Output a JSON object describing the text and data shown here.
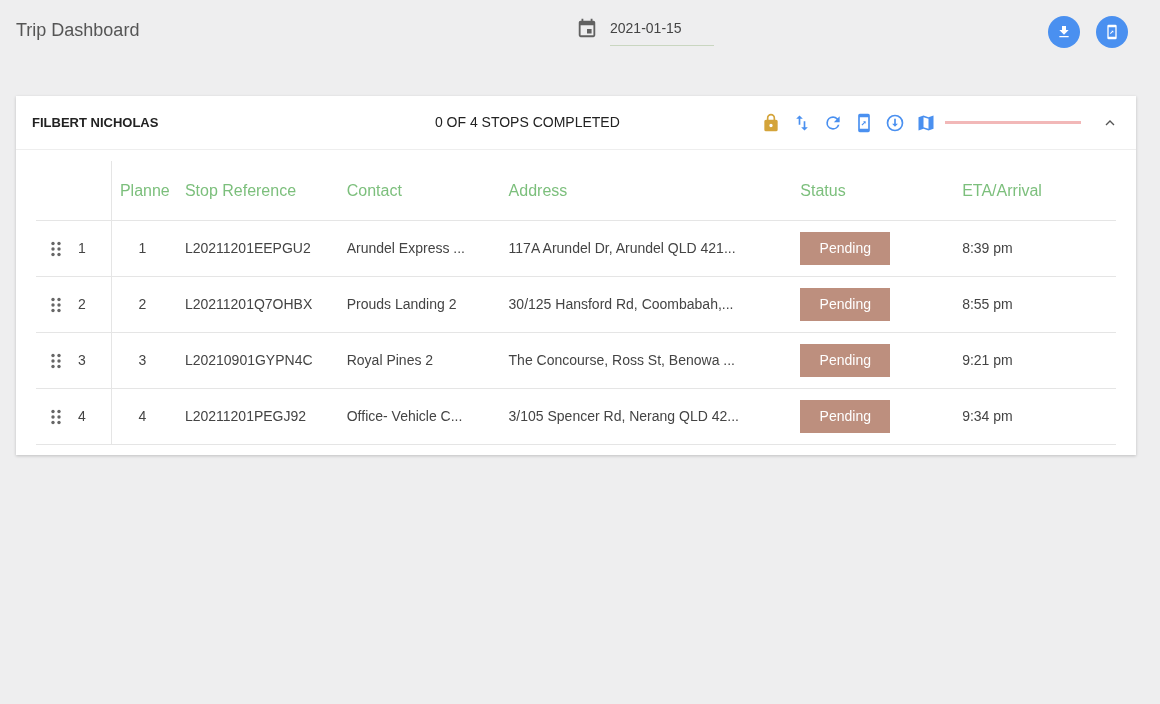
{
  "page_title": "Trip Dashboard",
  "date_field": {
    "value": "2021-01-15"
  },
  "trip": {
    "driver": "FILBERT NICHOLAS",
    "summary": "0 OF 4 STOPS COMPLETED",
    "progress": {
      "level": 0
    },
    "expanded": true,
    "columns": [
      "Planne",
      "Stop Reference",
      "Contact",
      "Address",
      "Status",
      "ETA/Arrival"
    ],
    "rows": [
      {
        "order": "1",
        "planned": "1",
        "reference": "L20211201EEPGU2",
        "contact": "Arundel Express ...",
        "address": "117A Arundel Dr, Arundel QLD 421...",
        "status": "Pending",
        "eta": "8:39 pm"
      },
      {
        "order": "2",
        "planned": "2",
        "reference": "L20211201Q7OHBX",
        "contact": "Prouds Landing 2",
        "address": "30/125 Hansford Rd, Coombabah,...",
        "status": "Pending",
        "eta": "8:55 pm"
      },
      {
        "order": "3",
        "planned": "3",
        "reference": "L20210901GYPN4C",
        "contact": "Royal Pines 2",
        "address": "The Concourse, Ross St, Benowa ...",
        "status": "Pending",
        "eta": "9:21 pm"
      },
      {
        "order": "4",
        "planned": "4",
        "reference": "L20211201PEGJ92",
        "contact": "Office- Vehicle C...",
        "address": "3/105 Spencer Rd, Nerang QLD 42...",
        "status": "Pending",
        "eta": "9:34 pm"
      }
    ]
  }
}
